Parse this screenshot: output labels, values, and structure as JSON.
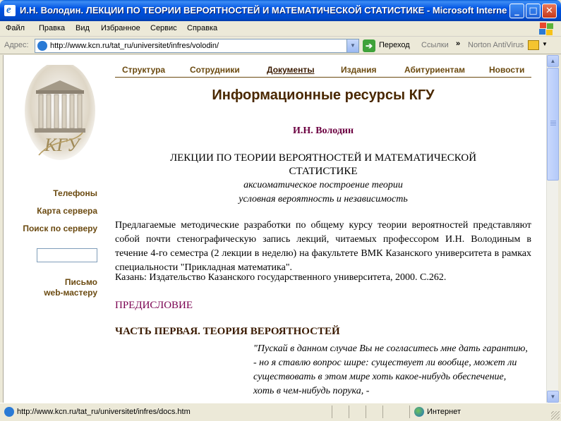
{
  "window": {
    "title": "И.Н. Володин. ЛЕКЦИИ ПО ТЕОРИИ ВЕРОЯТНОСТЕЙ И МАТЕМАТИЧЕСКОЙ СТАТИСТИКЕ - Microsoft Internet E...",
    "buttons": {
      "minimize": "_",
      "maximize": "□",
      "close": "✕"
    }
  },
  "menu": [
    "Файл",
    "Правка",
    "Вид",
    "Избранное",
    "Сервис",
    "Справка"
  ],
  "address_bar": {
    "label": "Адрес:",
    "url": "http://www.kcn.ru/tat_ru/universitet/infres/volodin/",
    "go_label": "Переход",
    "links_label": "Ссылки",
    "links_chevron": "»",
    "toolbar_item": "Norton AntiVirus"
  },
  "top_nav": [
    "Структура",
    "Сотрудники",
    "Документы",
    "Издания",
    "Абитуриентам",
    "Новости"
  ],
  "active_nav": "Документы",
  "left_nav": {
    "phones": "Телефоны",
    "sitemap": "Карта сервера",
    "search_label": "Поиск по серверу",
    "search_value": "",
    "mail_line1": "Письмо",
    "mail_line2": "web-мастеру"
  },
  "logo_letters": "КГУ",
  "content": {
    "page_title": "Информационные ресурсы КГУ",
    "author": "И.Н. Володин",
    "lecture_title": "ЛЕКЦИИ ПО ТЕОРИИ ВЕРОЯТНОСТЕЙ И МАТЕМАТИЧЕСКОЙ СТАТИСТИКЕ",
    "subtitle1": "аксиоматическое построение теории",
    "subtitle2": "условная вероятность и независимость",
    "intro": "Предлагаемые методические разработки по общему курсу теории вероятностей представляют собой почти стенографическую запись лекций, читаемых профессором И.Н. Володиным в течение 4-го семестра (2 лекции в неделю) на факультете ВМК Казанского университета в рамках специальности \"Прикладная математика\".",
    "publisher": "Казань: Издательство Казанского государственного университета, 2000. С.262.",
    "preface": "ПРЕДИСЛОВИЕ",
    "part1": "ЧАСТЬ ПЕРВАЯ.  ТЕОРИЯ ВЕРОЯТНОСТЕЙ",
    "quote": "\"Пускай в данном случае Вы не согласитесь мне дать гарантию, - но я ставлю вопрос шире: существует ли вообще, может ли существовать в этом мире хоть какое-нибудь обеспечение, хоть в чем-нибудь порука, -"
  },
  "status_bar": {
    "text": "http://www.kcn.ru/tat_ru/universitet/infres/docs.htm",
    "zone": "Интернет"
  },
  "colors": {
    "title_bar": "#0054e3",
    "nav_text": "#6b4a10",
    "author": "#6b0040",
    "preface_link": "#7a0050"
  }
}
